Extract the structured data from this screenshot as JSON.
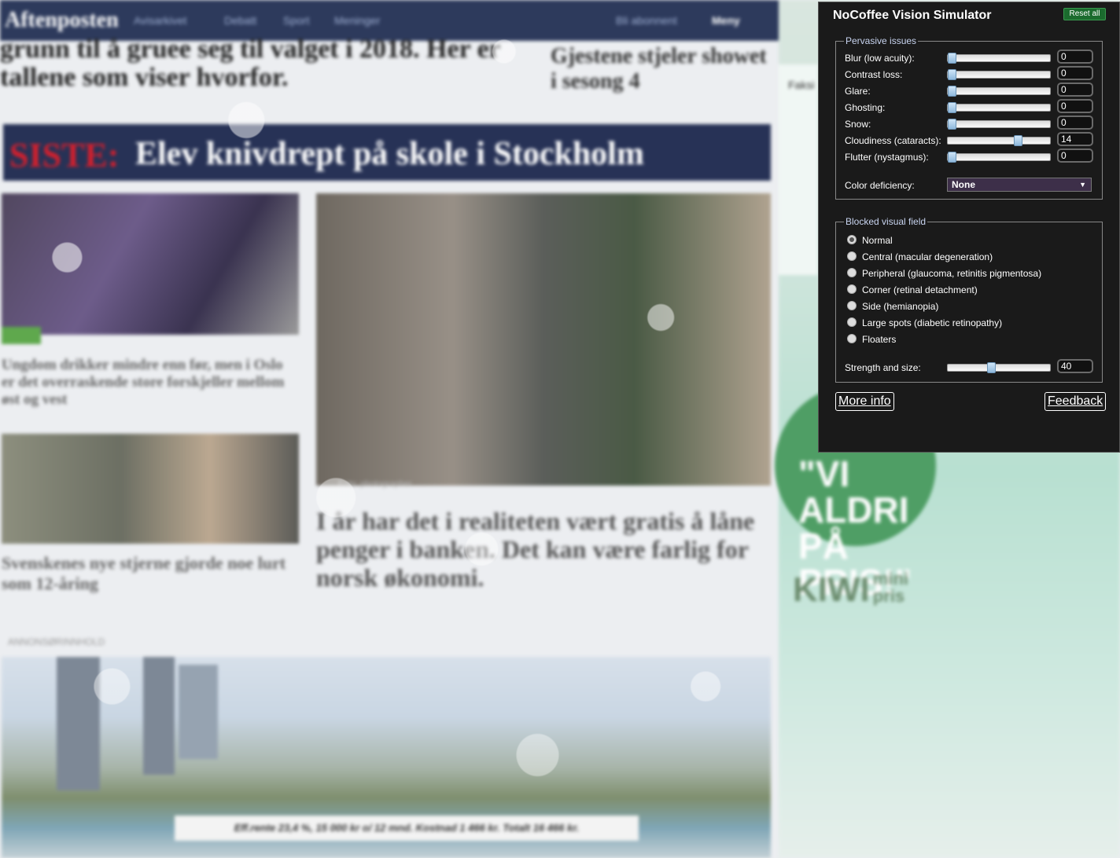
{
  "site": {
    "logo": "Aftenposten",
    "nav": [
      "Avisarkivet",
      "Debatt",
      "Sport",
      "Meninger"
    ],
    "subscribe": "Bli abonnent",
    "menu": "Meny",
    "hero_headline": "grunn til å gruee seg til valget i 2018. Her er tallene som viser hvorfor.",
    "side_headline": "Gjestene stjeler showet i sesong 4",
    "breaking_tag": "SISTE:",
    "breaking_text": "Elev knivdrept på skole i Stockholm",
    "card1_text": "Ungdom drikker mindre enn før, men i Oslo er det overraskende store forskjeller mellom øst og vest",
    "card2_text": "Svenskenes nye stjerne gjorde noe lurt som 12-åring",
    "big_text": "I år har det i realiteten vært gratis å låne penger i banken. Det kan være farlig for norsk økonomi.",
    "photo_caption": "Foto: photographer",
    "annons_label": "ANNONSØRINNHOLD",
    "ad_caption": "Eff.rente 23,4 %, 15 000 kr o/ 12 mnd. Kostnad 1 466 kr. Totalt 16 466 kr.",
    "faksimile": "Faksi",
    "circle_quote": "\"VI ALDRI PÅ PRIS!\"",
    "kiwi_main": "KIWI",
    "kiwi_sub1": "mini",
    "kiwi_sub2": "pris"
  },
  "panel": {
    "title": "NoCoffee Vision Simulator",
    "reset_label": "Reset all",
    "pervasive": {
      "legend": "Pervasive issues",
      "rows": [
        {
          "label": "Blur (low acuity):",
          "value": "0",
          "level": 0
        },
        {
          "label": "Contrast loss:",
          "value": "0",
          "level": 0
        },
        {
          "label": "Glare:",
          "value": "0",
          "level": 0
        },
        {
          "label": "Ghosting:",
          "value": "0",
          "level": 0
        },
        {
          "label": "Snow:",
          "value": "0",
          "level": 0
        },
        {
          "label": "Cloudiness (cataracts):",
          "value": "14",
          "level": 0.7
        },
        {
          "label": "Flutter (nystagmus):",
          "value": "0",
          "level": 0
        }
      ],
      "color_label": "Color deficiency:",
      "color_value": "None"
    },
    "blocked": {
      "legend": "Blocked visual field",
      "options": [
        "Normal",
        "Central (macular degeneration)",
        "Peripheral (glaucoma, retinitis pigmentosa)",
        "Corner (retinal detachment)",
        "Side (hemianopia)",
        "Large spots (diabetic retinopathy)",
        "Floaters"
      ],
      "selected": 0,
      "strength_label": "Strength and size:",
      "strength_value": "40",
      "strength_level": 0.42
    },
    "more_info": "More info",
    "feedback": "Feedback"
  }
}
